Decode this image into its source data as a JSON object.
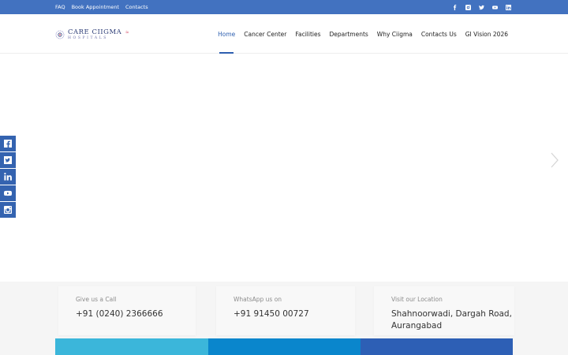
{
  "topbar": {
    "links": [
      "FAQ",
      "Book Appointment",
      "Contacts"
    ],
    "social_icons": [
      "facebook-icon",
      "instagram-icon",
      "twitter-icon",
      "youtube-icon",
      "linkedin-icon"
    ]
  },
  "header": {
    "logo_name": "CARE CIIGMA",
    "logo_sub": "HOSPITALS",
    "nav": [
      "Home",
      "Cancer Center",
      "Facilities",
      "Departments",
      "Why Ciigma",
      "Contacts Us",
      "GI Vision 2026"
    ],
    "active_nav": "Home"
  },
  "sidebar_social": [
    "facebook-icon",
    "twitter-icon",
    "linkedin-icon",
    "youtube-icon",
    "instagram-icon"
  ],
  "contact": {
    "call_label": "Give us a Call",
    "call_value": "+91 (0240) 2366666",
    "whatsapp_label": "WhatsApp us on",
    "whatsapp_value": "+91 91450 00727",
    "location_label": "Visit our Location",
    "location_line1": "Shahnoorwadi, Dargah Road,",
    "location_line2": "Aurangabad"
  },
  "colors": {
    "topbar": "#4272c0",
    "accent": "#2d5fb0",
    "bar1": "#3bb6da",
    "bar2": "#0a86cc",
    "bar3": "#2d5fb5"
  }
}
